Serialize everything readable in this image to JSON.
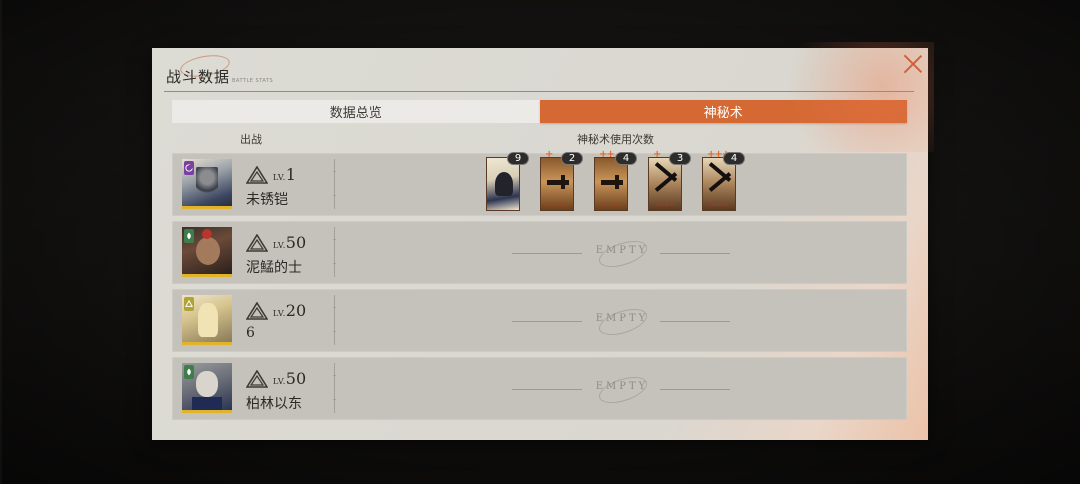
{
  "panel": {
    "title": "战斗数据",
    "subtitle": "BATTLE STATS"
  },
  "tabs": [
    {
      "label": "数据总览",
      "active": false
    },
    {
      "label": "神秘术",
      "active": true
    }
  ],
  "columns": {
    "deployed": "出战",
    "arcana_uses": "神秘术使用次数"
  },
  "lv_prefix": "LV.",
  "empty_label": "EMPTY",
  "rows": [
    {
      "level": "1",
      "name": "未锈铠",
      "badge_color": "#7a3fa0",
      "badge_icon": "moon-icon",
      "cards": [
        {
          "count": "9",
          "stars": "",
          "label": ""
        },
        {
          "count": "2",
          "stars": "+",
          "label": "Attack"
        },
        {
          "count": "4",
          "stars": "++",
          "label": "Attack"
        },
        {
          "count": "3",
          "stars": "+",
          "label": "Attack"
        },
        {
          "count": "4",
          "stars": "+++",
          "label": "Attack"
        }
      ]
    },
    {
      "level": "50",
      "name": "泥鯭的士",
      "badge_color": "#3f7d4a",
      "badge_icon": "leaf-icon",
      "cards": []
    },
    {
      "level": "20",
      "name": "6",
      "badge_color": "#b2a23a",
      "badge_icon": "triangle-icon",
      "cards": []
    },
    {
      "level": "50",
      "name": "柏林以东",
      "badge_color": "#3f7d4a",
      "badge_icon": "leaf-icon",
      "cards": []
    }
  ],
  "colors": {
    "accent": "#d56934",
    "row_bg": "#c4c2bb",
    "rarity_bar": "#e0b32a"
  }
}
